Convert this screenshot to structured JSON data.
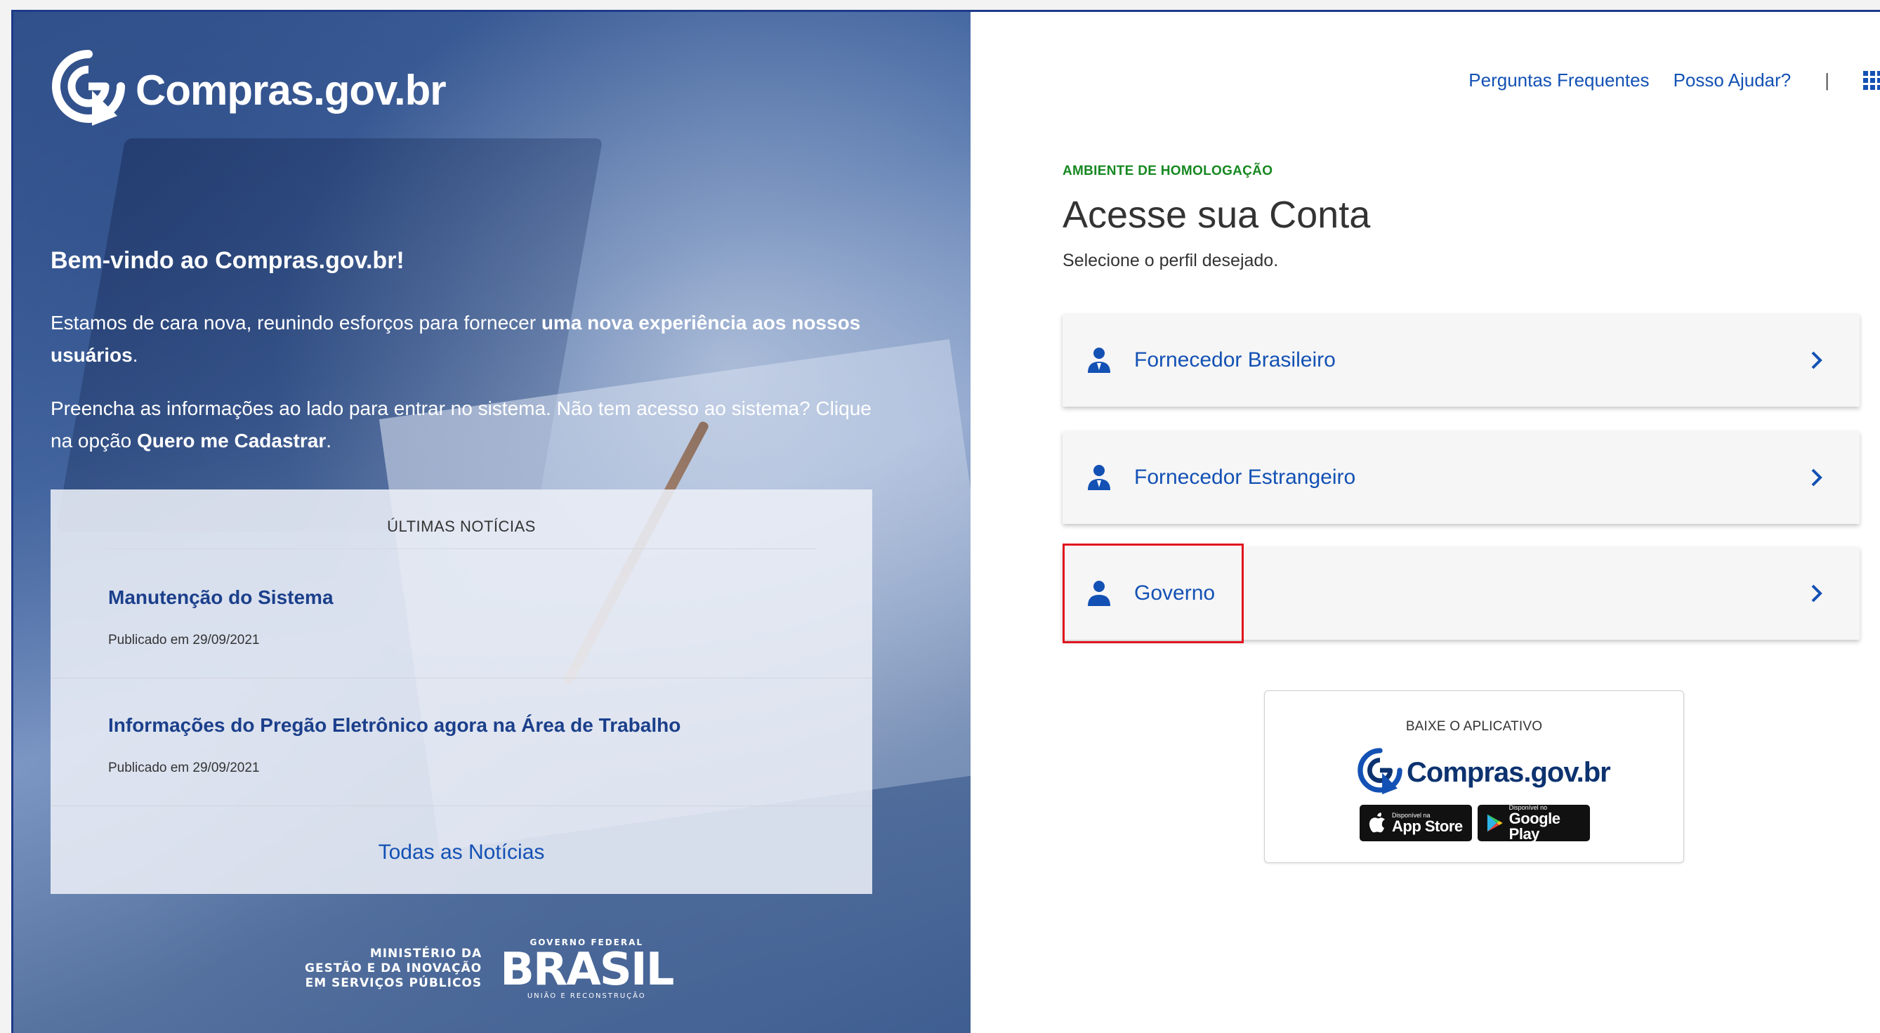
{
  "brand": {
    "name": "Compras.gov.br"
  },
  "welcome": {
    "title": "Bem-vindo ao Compras.gov.br!",
    "p1_a": "Estamos de cara nova, reunindo esforços para fornecer ",
    "p1_b": "uma nova experiência aos nossos usuários",
    "p1_c": ".",
    "p2_a": "Preencha as informações ao lado para entrar no sistema. Não tem acesso ao sistema? Clique na opção ",
    "p2_b": "Quero me Cadastrar",
    "p2_c": "."
  },
  "news": {
    "header": "ÚLTIMAS NOTÍCIAS",
    "items": [
      {
        "title": "Manutenção do Sistema",
        "date": "Publicado em 29/09/2021"
      },
      {
        "title": "Informações do Pregão Eletrônico agora na Área de Trabalho",
        "date": "Publicado em 29/09/2021"
      }
    ],
    "all_link": "Todas as Notícias"
  },
  "footer": {
    "ministry_line1": "MINISTÉRIO DA",
    "ministry_line2": "GESTÃO E DA INOVAÇÃO",
    "ministry_line3": "EM SERVIÇOS PÚBLICOS",
    "gov_top": "GOVERNO FEDERAL",
    "gov_main": "BRASIL",
    "gov_sub": "UNIÃO E RECONSTRUÇÃO"
  },
  "topnav": {
    "faq": "Perguntas Frequentes",
    "help": "Posso Ajudar?",
    "separator": "|"
  },
  "login": {
    "environment": "AMBIENTE DE HOMOLOGAÇÃO",
    "title": "Acesse sua Conta",
    "subtitle": "Selecione o perfil desejado.",
    "profiles": [
      {
        "label": "Fornecedor Brasileiro"
      },
      {
        "label": "Fornecedor Estrangeiro"
      },
      {
        "label": "Governo"
      }
    ]
  },
  "app": {
    "header": "BAIXE O APLICATIVO",
    "logo_text": "Compras.gov.br",
    "appstore_small": "Disponível na",
    "appstore_big": "App Store",
    "googleplay_small": "Disponível no",
    "googleplay_big": "Google Play"
  },
  "colors": {
    "accent": "#1351b4",
    "env_green": "#168821",
    "highlight_red": "#e0141e",
    "left_panel": "#4c6fa8"
  }
}
